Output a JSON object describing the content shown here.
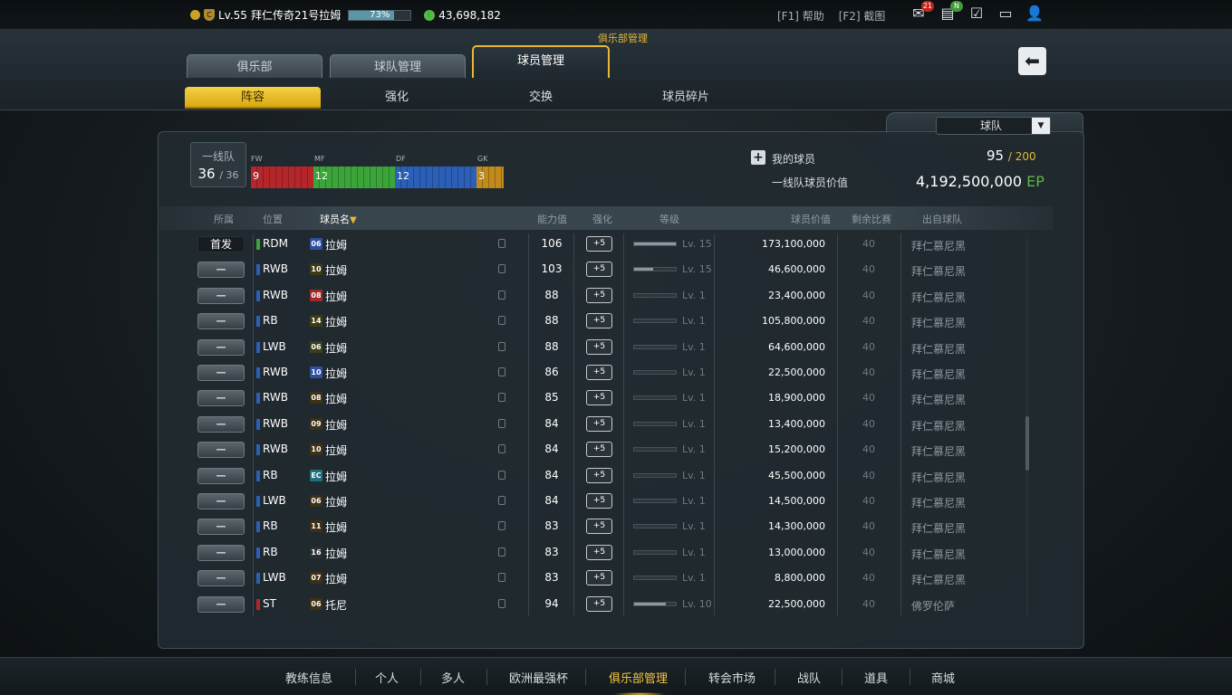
{
  "topbar": {
    "level": "Lv.55",
    "name": "拜仁传奇21号拉姆",
    "xp_percent": 73,
    "xp_text": "73%",
    "ep": "43,698,182",
    "hotkey_help": "[F1] 帮助",
    "hotkey_shot": "[F2] 截图",
    "mail_count": "21",
    "new_badge": "N"
  },
  "header": {
    "caption": "俱乐部管理",
    "tabs": [
      "俱乐部",
      "球队管理",
      "球员管理"
    ],
    "active_tab": "球员管理",
    "subtabs": [
      "阵容",
      "强化",
      "交换",
      "球员碎片"
    ],
    "active_subtab": "阵容"
  },
  "team_select": {
    "label": "球队"
  },
  "squad": {
    "label": "一线队",
    "count": "36",
    "max": "/ 36",
    "positions": [
      {
        "name": "FW",
        "count": "9",
        "color": "#b4262a"
      },
      {
        "name": "MF",
        "count": "12",
        "color": "#3ba53a"
      },
      {
        "name": "DF",
        "count": "12",
        "color": "#2c5fb8"
      },
      {
        "name": "GK",
        "count": "3",
        "color": "#c08a1c"
      }
    ]
  },
  "summary": {
    "my_players_label": "我的球员",
    "my_players_count": "95",
    "my_players_max": "/ 200",
    "value_label": "一线队球员价值",
    "value": "4,192,500,000",
    "value_unit": "EP"
  },
  "columns": {
    "affiliation": "所属",
    "position": "位置",
    "name": "球员名",
    "rating": "能力值",
    "enhance": "强化",
    "level": "等级",
    "value": "球员价值",
    "games": "剩余比赛",
    "club": "出自球队"
  },
  "enhance_label": "+5",
  "players": [
    {
      "role": "首发",
      "pos": "RDM",
      "poscolor": "#3ba53a",
      "num": "06",
      "numbg": "#2d4f9e",
      "name": "拉姆",
      "rating": "106",
      "lv": "Lv. 15",
      "lvfill": 1.0,
      "value": "173,100,000",
      "games": "40",
      "club": "拜仁慕尼黑"
    },
    {
      "role": "—",
      "pos": "RWB",
      "poscolor": "#2c5fb8",
      "num": "10",
      "numbg": "#3d3a14",
      "name": "拉姆",
      "rating": "103",
      "lv": "Lv. 15",
      "lvfill": 0.45,
      "value": "46,600,000",
      "games": "40",
      "club": "拜仁慕尼黑"
    },
    {
      "role": "—",
      "pos": "RWB",
      "poscolor": "#2c5fb8",
      "num": "08",
      "numbg": "#a02a2a",
      "name": "拉姆",
      "rating": "88",
      "lv": "Lv. 1",
      "lvfill": 0,
      "value": "23,400,000",
      "games": "40",
      "club": "拜仁慕尼黑"
    },
    {
      "role": "—",
      "pos": "RB",
      "poscolor": "#2c5fb8",
      "num": "14",
      "numbg": "#3d3a14",
      "name": "拉姆",
      "rating": "88",
      "lv": "Lv. 1",
      "lvfill": 0,
      "value": "105,800,000",
      "games": "40",
      "club": "拜仁慕尼黑"
    },
    {
      "role": "—",
      "pos": "LWB",
      "poscolor": "#2c5fb8",
      "num": "06",
      "numbg": "#3a3f1a",
      "name": "拉姆",
      "rating": "88",
      "lv": "Lv. 1",
      "lvfill": 0,
      "value": "64,600,000",
      "games": "40",
      "club": "拜仁慕尼黑"
    },
    {
      "role": "—",
      "pos": "RWB",
      "poscolor": "#2c5fb8",
      "num": "10",
      "numbg": "#2d4f9e",
      "name": "拉姆",
      "rating": "86",
      "lv": "Lv. 1",
      "lvfill": 0,
      "value": "22,500,000",
      "games": "40",
      "club": "拜仁慕尼黑"
    },
    {
      "role": "—",
      "pos": "RWB",
      "poscolor": "#2c5fb8",
      "num": "08",
      "numbg": "#3d3014",
      "name": "拉姆",
      "rating": "85",
      "lv": "Lv. 1",
      "lvfill": 0,
      "value": "18,900,000",
      "games": "40",
      "club": "拜仁慕尼黑"
    },
    {
      "role": "—",
      "pos": "RWB",
      "poscolor": "#2c5fb8",
      "num": "09",
      "numbg": "#3d3014",
      "name": "拉姆",
      "rating": "84",
      "lv": "Lv. 1",
      "lvfill": 0,
      "value": "13,400,000",
      "games": "40",
      "club": "拜仁慕尼黑"
    },
    {
      "role": "—",
      "pos": "RWB",
      "poscolor": "#2c5fb8",
      "num": "10",
      "numbg": "#3d3014",
      "name": "拉姆",
      "rating": "84",
      "lv": "Lv. 1",
      "lvfill": 0,
      "value": "15,200,000",
      "games": "40",
      "club": "拜仁慕尼黑"
    },
    {
      "role": "—",
      "pos": "RB",
      "poscolor": "#2c5fb8",
      "num": "EC",
      "numbg": "#1f6f7a",
      "name": "拉姆",
      "rating": "84",
      "lv": "Lv. 1",
      "lvfill": 0,
      "value": "45,500,000",
      "games": "40",
      "club": "拜仁慕尼黑"
    },
    {
      "role": "—",
      "pos": "LWB",
      "poscolor": "#2c5fb8",
      "num": "06",
      "numbg": "#3d3014",
      "name": "拉姆",
      "rating": "84",
      "lv": "Lv. 1",
      "lvfill": 0,
      "value": "14,500,000",
      "games": "40",
      "club": "拜仁慕尼黑"
    },
    {
      "role": "—",
      "pos": "RB",
      "poscolor": "#2c5fb8",
      "num": "11",
      "numbg": "#3d3014",
      "name": "拉姆",
      "rating": "83",
      "lv": "Lv. 1",
      "lvfill": 0,
      "value": "14,300,000",
      "games": "40",
      "club": "拜仁慕尼黑"
    },
    {
      "role": "—",
      "pos": "RB",
      "poscolor": "#2c5fb8",
      "num": "16",
      "numbg": "#2a2f33",
      "name": "拉姆",
      "rating": "83",
      "lv": "Lv. 1",
      "lvfill": 0,
      "value": "13,000,000",
      "games": "40",
      "club": "拜仁慕尼黑"
    },
    {
      "role": "—",
      "pos": "LWB",
      "poscolor": "#2c5fb8",
      "num": "07",
      "numbg": "#3d3014",
      "name": "拉姆",
      "rating": "83",
      "lv": "Lv. 1",
      "lvfill": 0,
      "value": "8,800,000",
      "games": "40",
      "club": "拜仁慕尼黑"
    },
    {
      "role": "—",
      "pos": "ST",
      "poscolor": "#b4262a",
      "num": "06",
      "numbg": "#3d3014",
      "name": "托尼",
      "rating": "94",
      "lv": "Lv. 10",
      "lvfill": 0.75,
      "value": "22,500,000",
      "games": "40",
      "club": "佛罗伦萨"
    }
  ],
  "bottom_nav": [
    "教练信息",
    "个人",
    "多人",
    "欧洲最强杯",
    "俱乐部管理",
    "转会市场",
    "战队",
    "道具",
    "商城"
  ],
  "bottom_active": "俱乐部管理"
}
